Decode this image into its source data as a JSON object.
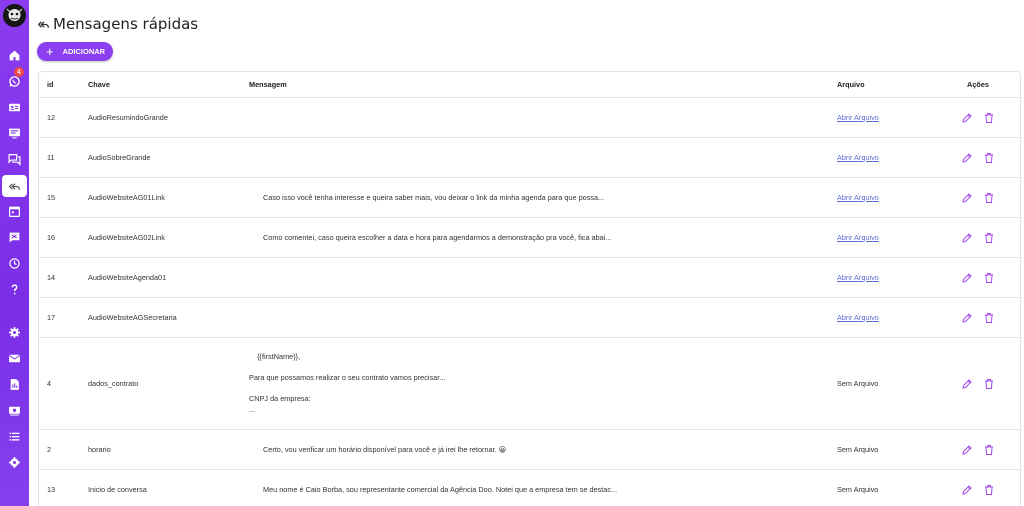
{
  "page": {
    "title": "Mensagens rápidas"
  },
  "toolbar": {
    "add_label": "ADICIONAR"
  },
  "sidebar": {
    "items": [
      {
        "icon": "home-icon"
      },
      {
        "icon": "whatsapp-icon",
        "badge": "4"
      },
      {
        "icon": "contacts-card-icon"
      },
      {
        "icon": "dashboard-screen-icon"
      },
      {
        "icon": "chat-bubbles-icon"
      },
      {
        "icon": "reply-all-icon",
        "active": true
      },
      {
        "icon": "calendar-icon"
      },
      {
        "icon": "tags-flag-icon"
      },
      {
        "icon": "clock-icon"
      },
      {
        "icon": "help-icon"
      },
      {
        "icon": "gear-icon"
      },
      {
        "icon": "message-board-icon"
      },
      {
        "icon": "document-icon"
      },
      {
        "icon": "money-icon"
      },
      {
        "icon": "list-icon"
      },
      {
        "icon": "settings-cog-icon"
      }
    ]
  },
  "table": {
    "headers": {
      "id": "id",
      "key": "Chave",
      "message": "Mensagem",
      "file": "Arquivo",
      "actions": "Ações"
    },
    "rows": [
      {
        "id": "12",
        "key": "AudioResumindoGrande",
        "message": "",
        "file": "Abrir Arquivo",
        "file_is_link": true
      },
      {
        "id": "11",
        "key": "AudioSobreGrande",
        "message": "",
        "file": "Abrir Arquivo",
        "file_is_link": true
      },
      {
        "id": "15",
        "key": "AudioWebsiteAG01Link",
        "message": "Caso isso você tenha interesse e queira saber mais, vou deixar o link da minha agenda para que possa...",
        "file": "Abrir Arquivo",
        "file_is_link": true
      },
      {
        "id": "16",
        "key": "AudioWebsiteAG02Link",
        "message": "Como comentei, caso queira escolher a data e hora para agendarmos a demonstração pra você, fica abai...",
        "file": "Abrir Arquivo",
        "file_is_link": true
      },
      {
        "id": "14",
        "key": "AudioWebsiteAgenda01",
        "message": "",
        "file": "Abrir Arquivo",
        "file_is_link": true
      },
      {
        "id": "17",
        "key": "AudioWebsiteAGSecretaria",
        "message": "",
        "file": "Abrir Arquivo",
        "file_is_link": true
      },
      {
        "id": "4",
        "key": "dados_contrato",
        "message_lines": [
          "    {{firstName}},",
          "",
          "Para que possamos realizar o seu contrato vamos precisar...",
          "",
          "CNPJ da empresa:",
          "..."
        ],
        "file": "Sem Arquivo",
        "file_is_link": false
      },
      {
        "id": "2",
        "key": "horario",
        "message": "Certo, vou verificar um horário disponível para você e já irei lhe retornar. 😀",
        "file": "Sem Arquivo",
        "file_is_link": false
      },
      {
        "id": "13",
        "key": "Inicio de conversa",
        "message": "Meu nome é Caio Borba, sou representante comercial da Agência Doo. Notei que a empresa tem se destac...",
        "file": "Sem Arquivo",
        "file_is_link": false
      }
    ]
  },
  "colors": {
    "accent": "#8a3ff0",
    "sidebar": "#7f33ea",
    "link": "#5b6bd8",
    "action_icon": "#a148e8"
  }
}
